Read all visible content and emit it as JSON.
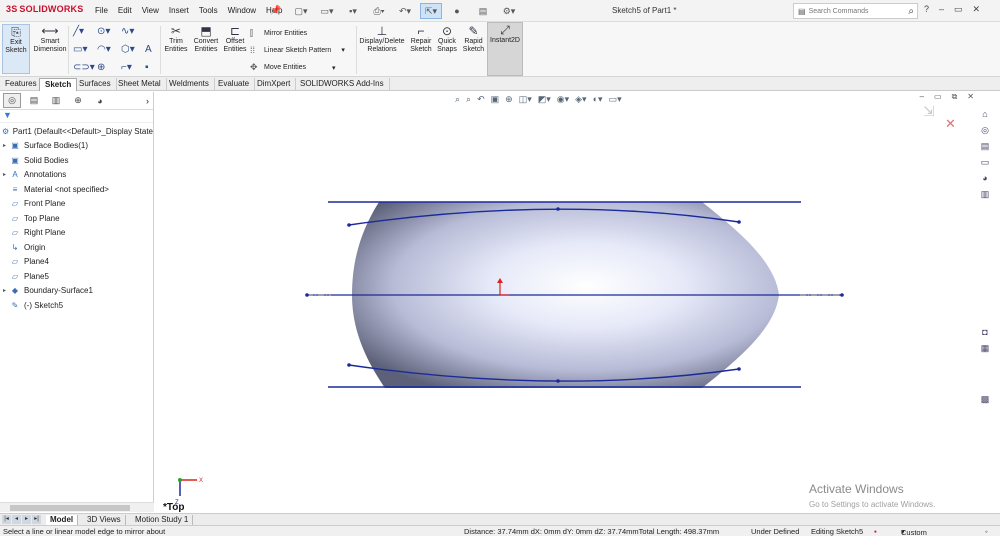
{
  "app": {
    "logo_text": "SOLIDWORKS",
    "logo_mark": "3S",
    "doc_title": "Sketch5 of Part1 *"
  },
  "menu": [
    "File",
    "Edit",
    "View",
    "Insert",
    "Tools",
    "Window",
    "Help"
  ],
  "search": {
    "placeholder": "Search Commands"
  },
  "ribbon": {
    "exit_sketch": "Exit\nSketch",
    "smart_dimension": "Smart\nDimension",
    "trim": "Trim\nEntities",
    "convert": "Convert\nEntities",
    "offset": "Offset\nEntities",
    "mirror": "Mirror Entities",
    "linear_pattern": "Linear Sketch Pattern",
    "move": "Move Entities",
    "display_relations": "Display/Delete\nRelations",
    "repair": "Repair\nSketch",
    "quick_snaps": "Quick\nSnaps",
    "rapid_sketch": "Rapid\nSketch",
    "instant2d": "Instant2D"
  },
  "tabs": [
    "Features",
    "Sketch",
    "Surfaces",
    "Sheet Metal",
    "Weldments",
    "Evaluate",
    "DimXpert",
    "SOLIDWORKS Add-Ins"
  ],
  "tree": [
    {
      "label": "Part1  (Default<<Default>_Display State",
      "icon": "part-icon",
      "glyph": "⚙"
    },
    {
      "label": "Surface Bodies(1)",
      "icon": "folder-icon",
      "glyph": "▣"
    },
    {
      "label": "Solid Bodies",
      "icon": "folder-icon",
      "glyph": "▣"
    },
    {
      "label": "Annotations",
      "icon": "annotations-icon",
      "glyph": "A"
    },
    {
      "label": "Material <not specified>",
      "icon": "material-icon",
      "glyph": "≡"
    },
    {
      "label": "Front Plane",
      "icon": "plane-icon",
      "glyph": "▱"
    },
    {
      "label": "Top Plane",
      "icon": "plane-icon",
      "glyph": "▱"
    },
    {
      "label": "Right Plane",
      "icon": "plane-icon",
      "glyph": "▱"
    },
    {
      "label": "Origin",
      "icon": "origin-icon",
      "glyph": "↳"
    },
    {
      "label": "Plane4",
      "icon": "plane-icon",
      "glyph": "▱"
    },
    {
      "label": "Plane5",
      "icon": "plane-icon",
      "glyph": "▱"
    },
    {
      "label": "Boundary-Surface1",
      "icon": "surface-icon",
      "glyph": "◆"
    },
    {
      "label": "(-) Sketch5",
      "icon": "sketch-icon",
      "glyph": "✎"
    }
  ],
  "view_label": "*Top",
  "watermark": {
    "title": "Activate Windows",
    "subtitle": "Go to Settings to activate Windows."
  },
  "bottom_tabs": [
    "Model",
    "3D Views",
    "Motion Study 1"
  ],
  "status": {
    "message": "Select a line or linear model edge to mirror about",
    "measure": "Distance: 37.74mm  dX: 0mm  dY: 0mm  dZ: 37.74mmTotal Length: 498.37mm",
    "state": "Under Defined",
    "editing": "Editing Sketch5",
    "units": "Custom"
  },
  "colors": {
    "accent": "#c8102e",
    "sketch_line": "#1a2a9a",
    "selection": "#cfe3f7"
  }
}
